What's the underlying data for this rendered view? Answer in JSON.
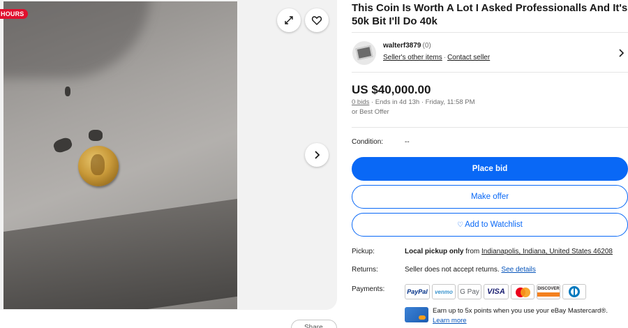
{
  "gallery": {
    "badge": "HOURS",
    "share_label": "Share"
  },
  "item": {
    "title": "This Coin Is Worth A Lot I Asked Professionalls And It's 50k Bit I'll Do 40k"
  },
  "seller": {
    "name": "walterf3879",
    "feedback": "(0)",
    "other_items": "Seller's other items",
    "separator": "·",
    "contact": "Contact seller"
  },
  "pricing": {
    "price": "US $40,000.00",
    "bids_link": "0 bids",
    "ends_text": " · Ends in 4d 13h · Friday, 11:58 PM",
    "best_offer": "or Best Offer"
  },
  "condition": {
    "label": "Condition:",
    "value": "--"
  },
  "actions": {
    "place_bid": "Place bid",
    "make_offer": "Make offer",
    "watchlist": "Add to Watchlist"
  },
  "pickup": {
    "label": "Pickup:",
    "bold": "Local pickup only",
    "from": " from ",
    "location": "Indianapolis, Indiana, United States 46208"
  },
  "returns": {
    "label": "Returns:",
    "value": "Seller does not accept returns. ",
    "link": "See details"
  },
  "payments": {
    "label": "Payments:",
    "methods": [
      "PayPal",
      "venmo",
      "G Pay",
      "VISA",
      "mastercard",
      "DISCOVER",
      "Diners Club"
    ]
  },
  "promo": {
    "text": "Earn up to 5x points when you use your eBay Mastercard®.",
    "link": "Learn more"
  },
  "colors": {
    "primary": "#0968f6",
    "badge": "#e0102e",
    "link": "#0654ba"
  }
}
